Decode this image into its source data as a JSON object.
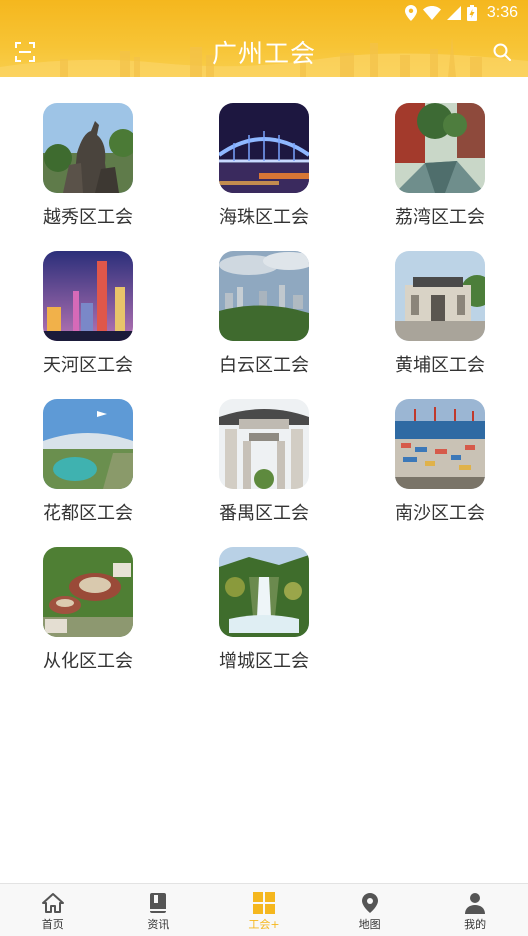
{
  "status": {
    "time": "3:36"
  },
  "header": {
    "title": "广州工会",
    "scan_icon": "scan-icon",
    "search_icon": "search-icon"
  },
  "colors": {
    "accent": "#f5b71e",
    "text": "#333333",
    "nav_bg": "#f8f8f8"
  },
  "districts": [
    {
      "label": "越秀区工会",
      "image": "five-goats-statue"
    },
    {
      "label": "海珠区工会",
      "image": "haizhu-bridge-night"
    },
    {
      "label": "荔湾区工会",
      "image": "liwan-canal-street"
    },
    {
      "label": "天河区工会",
      "image": "tianhe-skyline-night"
    },
    {
      "label": "白云区工会",
      "image": "baiyun-mountain-city"
    },
    {
      "label": "黄埔区工会",
      "image": "huangpu-military-academy"
    },
    {
      "label": "花都区工会",
      "image": "huadu-airport"
    },
    {
      "label": "番禺区工会",
      "image": "panyu-archway"
    },
    {
      "label": "南沙区工会",
      "image": "nansha-port"
    },
    {
      "label": "从化区工会",
      "image": "conghua-tulou"
    },
    {
      "label": "增城区工会",
      "image": "zengcheng-waterfall"
    }
  ],
  "bottom_nav": [
    {
      "label": "首页",
      "icon": "home-icon",
      "active": false
    },
    {
      "label": "资讯",
      "icon": "book-icon",
      "active": false
    },
    {
      "label": "工会+",
      "icon": "grid-icon",
      "active": true
    },
    {
      "label": "地图",
      "icon": "map-pin-icon",
      "active": false
    },
    {
      "label": "我的",
      "icon": "user-icon",
      "active": false
    }
  ]
}
